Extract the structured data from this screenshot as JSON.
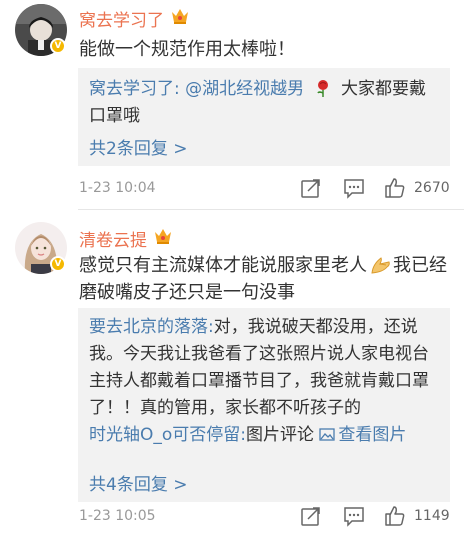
{
  "comments": [
    {
      "username": "窝去学习了",
      "text": "能做一个规范作用太棒啦！",
      "reply": {
        "author": "窝去学习了:",
        "mention": "@湖北经视越男",
        "emoji": "rose-emoji",
        "body": "大家都要戴口罩哦"
      },
      "reply_count": "共2条回复 >",
      "timestamp": "1-23 10:04",
      "likes": "2670"
    },
    {
      "username": "清卷云提",
      "text_before_emoji": "感觉只有主流媒体才能说服家里老人",
      "emoji": "praying-hands-emoji",
      "text_after_emoji": "我已经磨破嘴皮子还只是一句没事",
      "reply": {
        "author": "要去北京的落落:",
        "body": "对，我说破天都没用，还说我。今天我让我爸看了这张照片说人家电视台主持人都戴着口罩播节目了，我爸就肯戴口罩了！！真的管用，家长都不听孩子的"
      },
      "reply2": {
        "author": "时光轴O_o可否停留:",
        "body": "图片评论",
        "link": "查看图片"
      },
      "reply_count": "共4条回复 >",
      "timestamp": "1-23 10:05",
      "likes": "1149"
    }
  ],
  "colors": {
    "username": "#eb7350",
    "link": "#4a7cae",
    "reply_bg": "#f2f2f2",
    "meta": "#999999"
  },
  "icons": [
    "crown-icon",
    "verified-badge-icon",
    "repost-icon",
    "reply-icon",
    "like-icon",
    "image-icon"
  ]
}
